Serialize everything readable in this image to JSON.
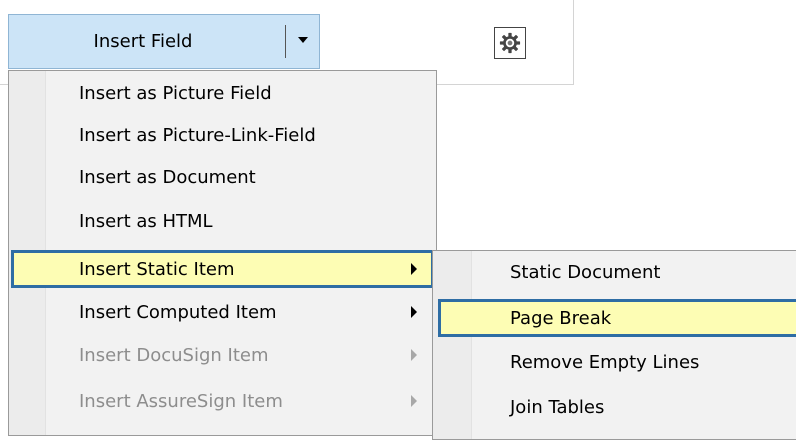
{
  "toolbar": {
    "insert_field_label": "Insert Field",
    "dropdown_icon": "chevron-down-icon",
    "settings_icon": "gear-icon"
  },
  "menu": {
    "items": [
      {
        "label": "Insert as Picture Field",
        "enabled": true,
        "has_submenu": false,
        "highlighted": false
      },
      {
        "label": "Insert as Picture-Link-Field",
        "enabled": true,
        "has_submenu": false,
        "highlighted": false
      },
      {
        "label": "Insert as Document",
        "enabled": true,
        "has_submenu": false,
        "highlighted": false
      },
      {
        "label": "Insert as HTML",
        "enabled": true,
        "has_submenu": false,
        "highlighted": false
      },
      {
        "label": "Insert Static Item",
        "enabled": true,
        "has_submenu": true,
        "highlighted": true
      },
      {
        "label": "Insert Computed Item",
        "enabled": true,
        "has_submenu": true,
        "highlighted": false
      },
      {
        "label": "Insert DocuSign Item",
        "enabled": false,
        "has_submenu": true,
        "highlighted": false
      },
      {
        "label": "Insert AssureSign Item",
        "enabled": false,
        "has_submenu": true,
        "highlighted": false
      }
    ]
  },
  "submenu": {
    "items": [
      {
        "label": "Static Document",
        "highlighted": false
      },
      {
        "label": "Page Break",
        "highlighted": true
      },
      {
        "label": "Remove Empty Lines",
        "highlighted": false
      },
      {
        "label": "Join Tables",
        "highlighted": false
      }
    ]
  },
  "colors": {
    "button_bg": "#cce4f7",
    "highlight_bg": "#fdfdb4",
    "highlight_border": "#2e6da4",
    "disabled_text": "#8d8d8d"
  }
}
